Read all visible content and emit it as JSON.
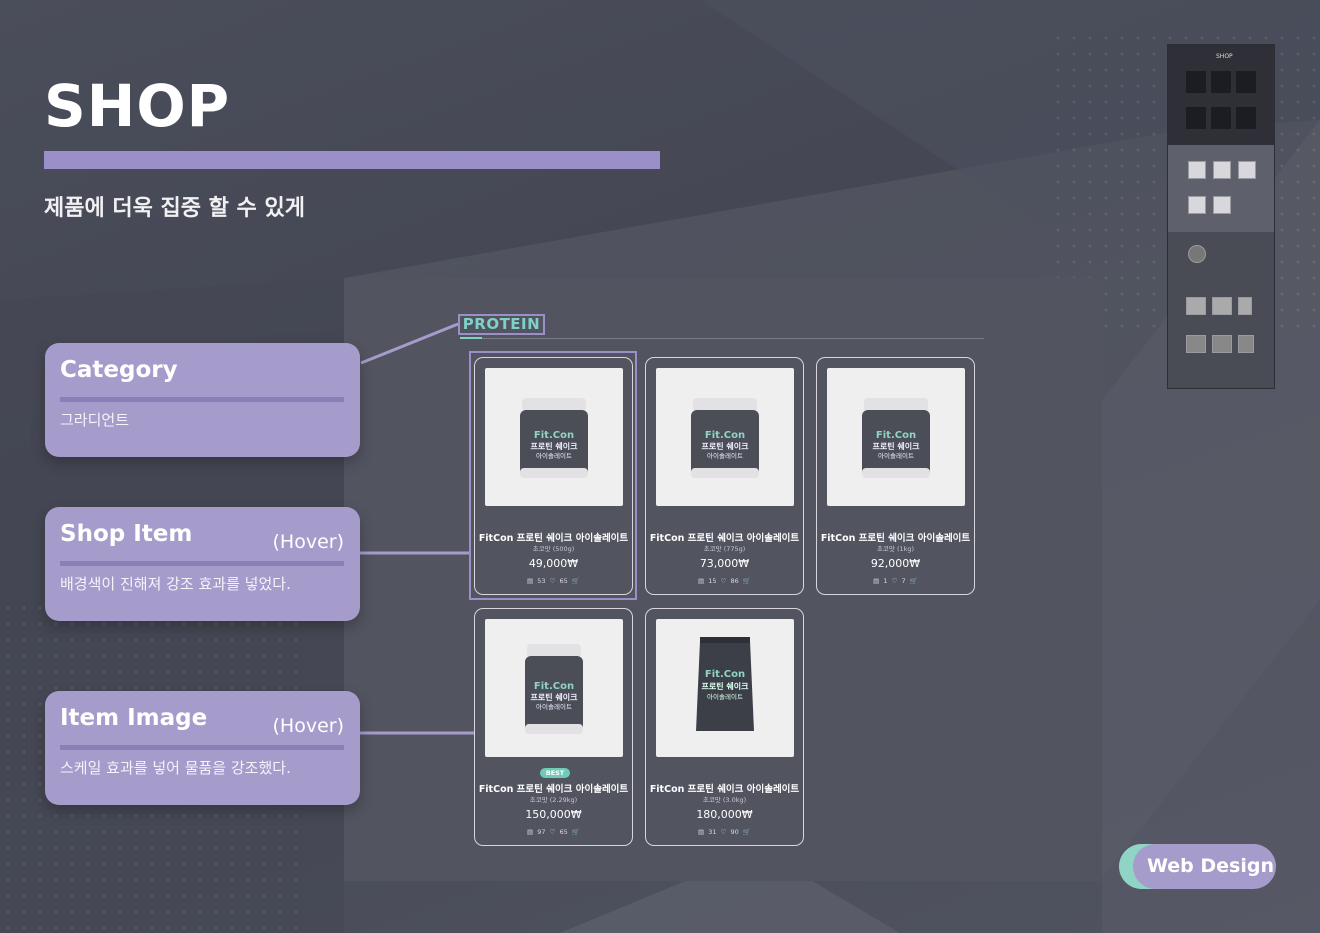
{
  "header": {
    "title": "SHOP",
    "subtitle": "제품에 더욱 집중 할 수 있게"
  },
  "labels": [
    {
      "title": "Category",
      "hover": "",
      "desc": "그라디언트"
    },
    {
      "title": "Shop Item",
      "hover": "(Hover)",
      "desc": "배경색이 진해져 강조 효과를 넣었다."
    },
    {
      "title": "Item Image",
      "hover": "(Hover)",
      "desc": "스케일 효과를 넣어 물품을 강조했다."
    }
  ],
  "category": {
    "tag": "PROTEIN"
  },
  "products": [
    {
      "name": "FitCon 프로틴 쉐이크 아이솔레이트",
      "option": "초코맛 (500g)",
      "price": "49,000₩",
      "reviews": "53",
      "likes": "65",
      "badge": ""
    },
    {
      "name": "FitCon 프로틴 쉐이크 아이솔레이트",
      "option": "초코맛 (775g)",
      "price": "73,000₩",
      "reviews": "15",
      "likes": "86",
      "badge": ""
    },
    {
      "name": "FitCon 프로틴 쉐이크 아이솔레이트",
      "option": "초코맛 (1kg)",
      "price": "92,000₩",
      "reviews": "1",
      "likes": "7",
      "badge": ""
    },
    {
      "name": "FitCon 프로틴 쉐이크 아이솔레이트",
      "option": "초코맛 (2.29kg)",
      "price": "150,000₩",
      "reviews": "97",
      "likes": "65",
      "badge": "BEST"
    },
    {
      "name": "FitCon 프로틴 쉐이크 아이솔레이트",
      "option": "초코맛 (3.0kg)",
      "price": "180,000₩",
      "reviews": "31",
      "likes": "90",
      "badge": ""
    }
  ],
  "package": {
    "brand": "Fit.Con",
    "line1": "프로틴 쉐이크",
    "line2": "아이솔레이트"
  },
  "thumbnail": {
    "title": "SHOP"
  },
  "footer": {
    "badge": "Web Design"
  },
  "colors": {
    "accent": "#9a8fc9",
    "teal": "#7fd1c7",
    "background": "#474a56"
  }
}
